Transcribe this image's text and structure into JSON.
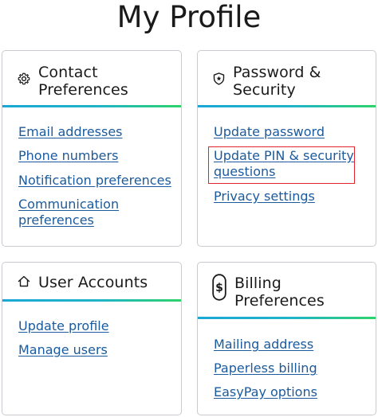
{
  "page": {
    "title": "My Profile"
  },
  "cards": {
    "contact": {
      "title": "Contact\nPreferences",
      "icon": "gear-icon",
      "links": [
        "Email addresses",
        "Phone numbers",
        "Notification preferences",
        "Communication\npreferences"
      ]
    },
    "security": {
      "title": "Password &\nSecurity",
      "icon": "shield-icon",
      "links": [
        "Update password",
        "Update PIN & security\nquestions",
        "Privacy settings"
      ]
    },
    "accounts": {
      "title": "User Accounts",
      "icon": "home-icon",
      "links": [
        "Update profile",
        "Manage users"
      ]
    },
    "billing": {
      "title": "Billing\nPreferences",
      "icon": "dollar-icon",
      "links": [
        "Mailing address",
        "Paperless billing",
        "EasyPay options"
      ]
    }
  },
  "colors": {
    "link": "#1b5a9c",
    "divider_start": "#1aa7d6",
    "divider_end": "#2ed36a",
    "highlight": "#e0252f"
  }
}
